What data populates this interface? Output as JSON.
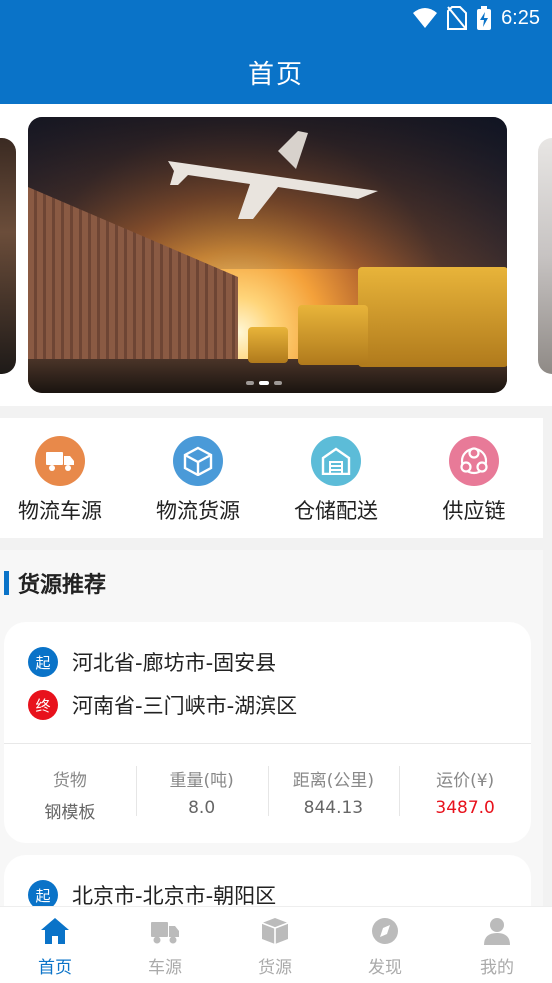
{
  "status_bar": {
    "time": "6:25"
  },
  "header": {
    "title": "首页"
  },
  "banner": {
    "active_index": 1,
    "dot_count": 3
  },
  "quick_menu": [
    {
      "label": "物流车源",
      "icon": "truck-icon",
      "color": "#e8894a"
    },
    {
      "label": "物流货源",
      "icon": "box-icon",
      "color": "#4a9ad8"
    },
    {
      "label": "仓储配送",
      "icon": "warehouse-icon",
      "color": "#5cbcd8"
    },
    {
      "label": "供应链",
      "icon": "supply-chain-icon",
      "color": "#e87a98"
    }
  ],
  "section": {
    "title": "货源推荐"
  },
  "cards": [
    {
      "start_tag": "起",
      "start": "河北省-廊坊市-固安县",
      "end_tag": "终",
      "end": "河南省-三门峡市-湖滨区",
      "stats": [
        {
          "key": "货物",
          "value": "钢模板"
        },
        {
          "key": "重量(吨)",
          "value": "8.0"
        },
        {
          "key": "距离(公里)",
          "value": "844.13"
        },
        {
          "key": "运价(¥)",
          "value": "3487.0"
        }
      ]
    },
    {
      "start_tag": "起",
      "start": "北京市-北京市-朝阳区"
    }
  ],
  "tab_bar": [
    {
      "label": "首页",
      "icon": "home-icon",
      "active": true
    },
    {
      "label": "车源",
      "icon": "truck-icon"
    },
    {
      "label": "货源",
      "icon": "package-icon"
    },
    {
      "label": "发现",
      "icon": "compass-icon"
    },
    {
      "label": "我的",
      "icon": "user-icon"
    }
  ],
  "colors": {
    "primary": "#0a73c8",
    "price": "#e8121c",
    "end_tag": "#e8121c"
  }
}
